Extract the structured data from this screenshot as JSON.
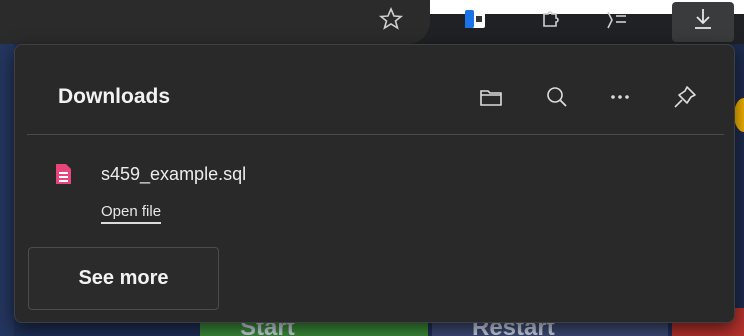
{
  "downloads_panel": {
    "title": "Downloads",
    "actions": [
      {
        "name": "open-folder",
        "icon": "folder-icon"
      },
      {
        "name": "search",
        "icon": "search-icon"
      },
      {
        "name": "more-options",
        "icon": "more-horizontal-icon"
      },
      {
        "name": "pin",
        "icon": "pin-icon"
      }
    ],
    "items": [
      {
        "file_name": "s459_example.sql",
        "action_label": "Open file",
        "icon": "file-icon",
        "icon_color": "#e8457a"
      }
    ],
    "see_more_label": "See more"
  },
  "page_buttons": {
    "start_label": "Start",
    "restart_label": "Restart"
  },
  "colors": {
    "panel_bg": "#292929",
    "toolbar_bg": "#202124",
    "page_bg": "#1f2f57",
    "file_icon": "#e8457a"
  }
}
